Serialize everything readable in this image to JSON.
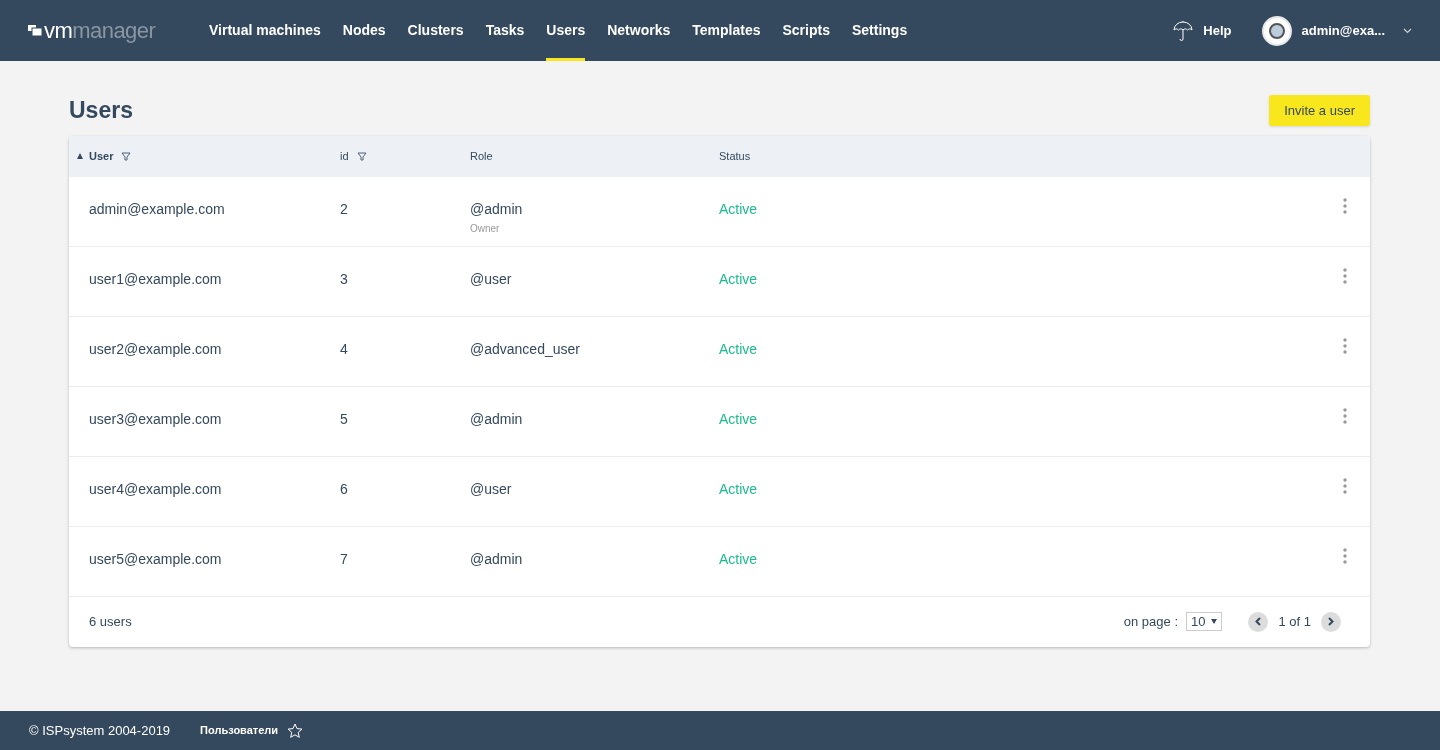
{
  "logo": {
    "prefix": "vm",
    "suffix": "manager"
  },
  "nav": [
    {
      "label": "Virtual machines",
      "selected": false
    },
    {
      "label": "Nodes",
      "selected": false
    },
    {
      "label": "Clusters",
      "selected": false
    },
    {
      "label": "Tasks",
      "selected": false
    },
    {
      "label": "Users",
      "selected": true
    },
    {
      "label": "Networks",
      "selected": false
    },
    {
      "label": "Templates",
      "selected": false
    },
    {
      "label": "Scripts",
      "selected": false
    },
    {
      "label": "Settings",
      "selected": false
    }
  ],
  "help": "Help",
  "account": "admin@exa...",
  "page_title": "Users",
  "invite_button": "Invite a user",
  "table": {
    "columns": [
      {
        "label": "User",
        "sorted": true,
        "filter": true
      },
      {
        "label": "id",
        "sorted": false,
        "filter": true
      },
      {
        "label": "Role",
        "sorted": false,
        "filter": false
      },
      {
        "label": "Status",
        "sorted": false,
        "filter": false
      }
    ],
    "rows": [
      {
        "user": "admin@example.com",
        "id": "2",
        "role": "@admin",
        "role_note": "Owner",
        "status": "Active"
      },
      {
        "user": "user1@example.com",
        "id": "3",
        "role": "@user",
        "status": "Active"
      },
      {
        "user": "user2@example.com",
        "id": "4",
        "role": "@advanced_user",
        "status": "Active"
      },
      {
        "user": "user3@example.com",
        "id": "5",
        "role": "@admin",
        "status": "Active"
      },
      {
        "user": "user4@example.com",
        "id": "6",
        "role": "@user",
        "status": "Active"
      },
      {
        "user": "user5@example.com",
        "id": "7",
        "role": "@admin",
        "status": "Active"
      }
    ],
    "total": "6 users",
    "per_page_label": "on page :",
    "per_page": "10",
    "page_info": "1 of 1"
  },
  "footer": {
    "copyright": "© ISPsystem 2004-2019",
    "breadcrumb": "Пользователи"
  }
}
